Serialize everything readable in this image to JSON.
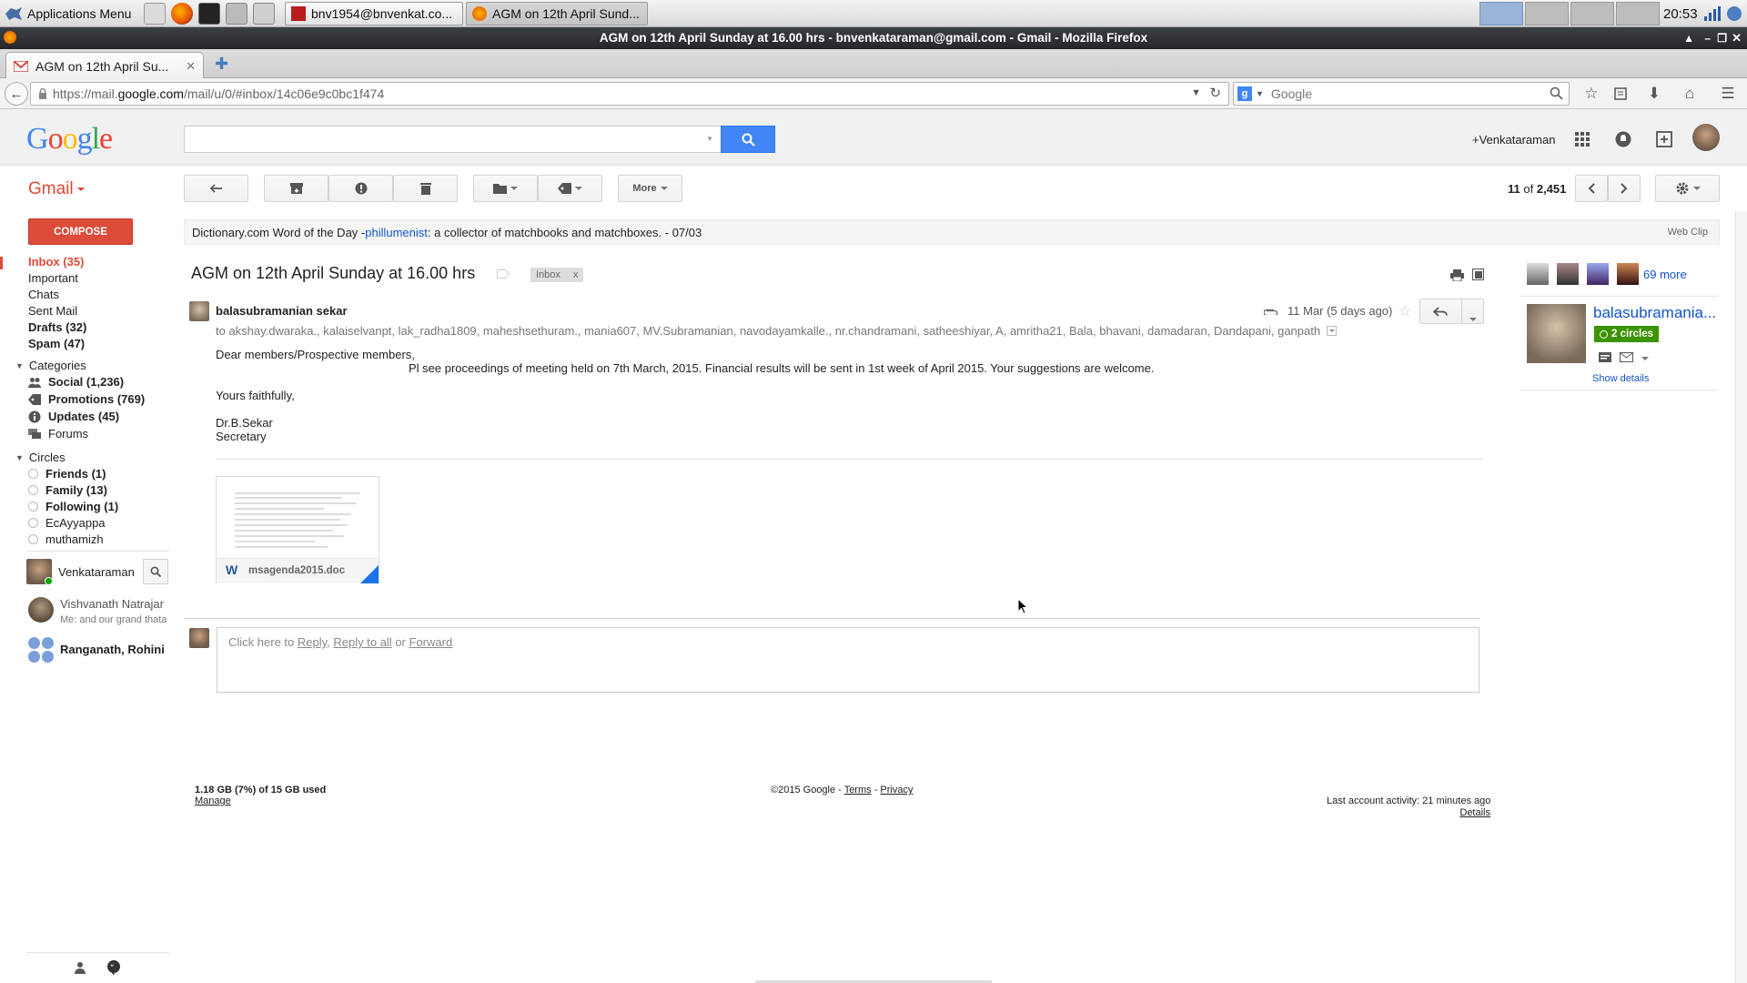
{
  "taskbar": {
    "apps_menu": "Applications Menu",
    "tasks": [
      "bnv1954@bnvenkat.co...",
      "AGM on 12th April Sund..."
    ],
    "clock": "20:53"
  },
  "window": {
    "title": "AGM on 12th April Sunday at 16.00 hrs - bnvenkataraman@gmail.com - Gmail - Mozilla Firefox"
  },
  "browser": {
    "tab_title": "AGM on 12th April Su...",
    "url_prefix": "https://mail.",
    "url_domain": "google.com",
    "url_path": "/mail/u/0/#inbox/14c06e9c0bc1f474",
    "search_placeholder": "Google"
  },
  "gheader": {
    "logo": "Google",
    "user_link": "+Venkataraman"
  },
  "toolbar": {
    "gmail_label": "Gmail",
    "more_label": "More",
    "pager_pos": "11",
    "pager_of": "of",
    "pager_total": "2,451"
  },
  "sidebar": {
    "compose": "COMPOSE",
    "inbox": "Inbox (35)",
    "important": "Important",
    "chats": "Chats",
    "sent": "Sent Mail",
    "drafts": "Drafts (32)",
    "spam": "Spam (47)",
    "categories_header": "Categories",
    "categories": [
      {
        "label": "Social (1,236)",
        "bold": true
      },
      {
        "label": "Promotions (769)",
        "bold": true
      },
      {
        "label": "Updates (45)",
        "bold": true
      },
      {
        "label": "Forums",
        "bold": false
      }
    ],
    "circles_header": "Circles",
    "circles": [
      {
        "label": "Friends (1)",
        "bold": true
      },
      {
        "label": "Family (13)",
        "bold": true
      },
      {
        "label": "Following (1)",
        "bold": true
      },
      {
        "label": "EcAyyappa",
        "bold": false
      },
      {
        "label": "muthamizh",
        "bold": false
      }
    ],
    "hangout_user": "Venkataraman",
    "hangouts": [
      {
        "name": "Vishvanath Natrajar",
        "snippet": "Me: and our grand thata"
      },
      {
        "name": "Ranganath, Rohini",
        "snippet": ""
      }
    ]
  },
  "webclip": {
    "prefix": "Dictionary.com Word of the Day - ",
    "word": "phillumenist",
    "definition": ": a collector of matchbooks and matchboxes. - 07/03",
    "tag": "Web Clip"
  },
  "message": {
    "subject": "AGM on 12th April Sunday at 16.00 hrs",
    "label": "Inbox",
    "label_x": "x",
    "sender": "balasubramanian sekar",
    "date": "11 Mar (5 days ago)",
    "recipients": "to akshay.dwaraka., kalaiselvanpt, lak_radha1809, maheshsethuram., mania607, MV.Subramanian, navodayamkalle., nr.chandramani, satheeshiyar, A, amritha21, Bala, bhavani, damadaran, Dandapani, ganpath",
    "body_greeting": "Dear members/Prospective members,",
    "body_line": "Pl see proceedings of meeting held on 7th March, 2015. Financial results will be sent in 1st week of April 2015. Your suggestions are welcome.",
    "body_closing": "Yours faithfully,",
    "signature_name": "Dr.B.Sekar",
    "signature_title": "Secretary",
    "attachment_name": "msagenda2015.doc",
    "reply_prefix": "Click here to ",
    "reply_link": "Reply",
    "reply_sep": ", ",
    "reply_all_link": "Reply to all",
    "reply_or": " or ",
    "forward_link": "Forward"
  },
  "people": {
    "more": "69 more",
    "contact_name": "balasubramania...",
    "circles_badge": "2 circles",
    "show_details": "Show details"
  },
  "footer": {
    "storage": "1.18 GB (7%) of 15 GB used",
    "manage": "Manage",
    "copyright": "©2015 Google - ",
    "terms": "Terms",
    "sep": " - ",
    "privacy": "Privacy",
    "activity": "Last account activity: 21 minutes ago",
    "details": "Details"
  }
}
